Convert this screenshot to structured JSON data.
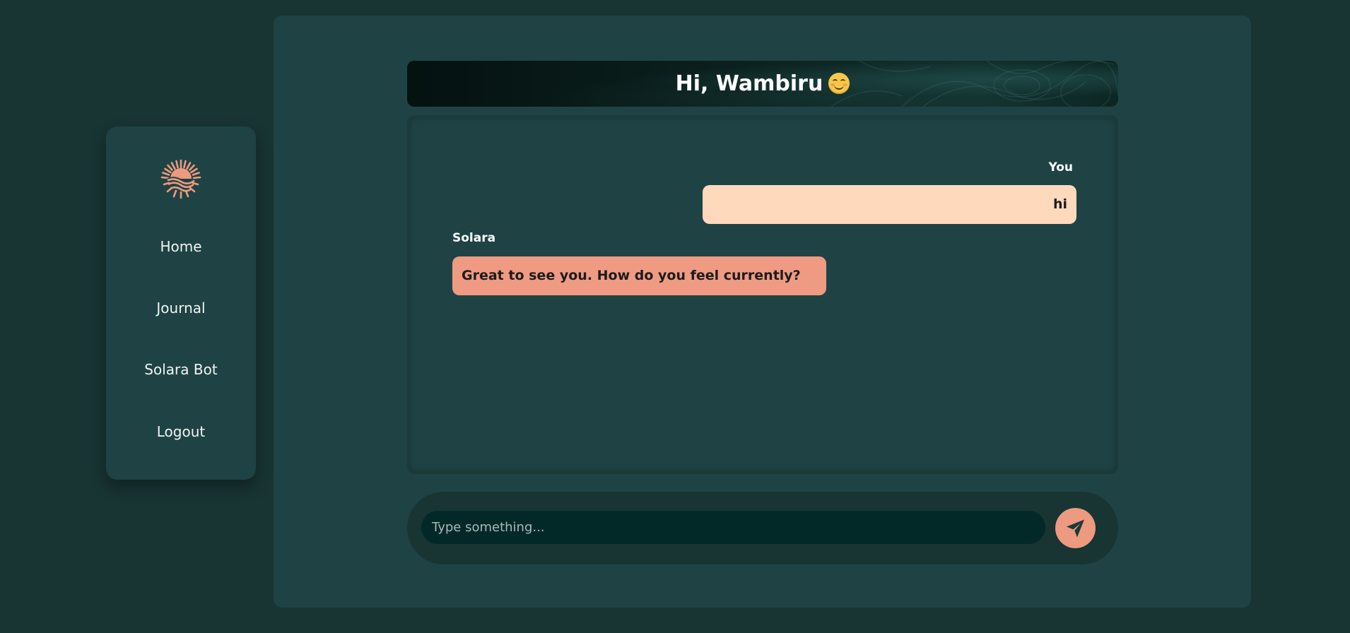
{
  "nav": {
    "items": [
      {
        "label": "Home"
      },
      {
        "label": "Journal"
      },
      {
        "label": "Solara Bot"
      },
      {
        "label": "Logout"
      }
    ]
  },
  "header": {
    "greeting": "Hi, Wambiru"
  },
  "chat": {
    "messages": [
      {
        "sender": "You",
        "text": "hi"
      },
      {
        "sender": "Solara",
        "text": "Great to see you. How do you feel currently?"
      }
    ]
  },
  "composer": {
    "placeholder": "Type something..."
  },
  "colors": {
    "background": "#183433",
    "panel": "#1f4344",
    "user_bubble": "#fed9bc",
    "bot_bubble": "#ef9b83",
    "accent": "#ee9a80",
    "input": "#022928"
  },
  "icons": {
    "logo": "sun-over-waves-icon",
    "send": "paper-plane-icon",
    "emoji": "smiling-face-icon"
  }
}
